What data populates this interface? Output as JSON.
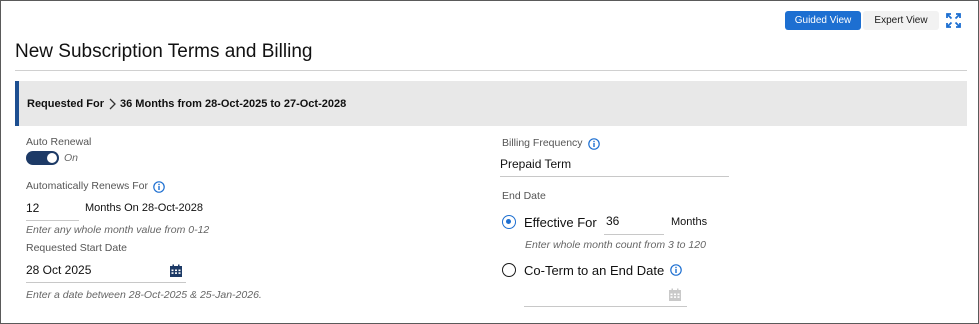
{
  "view_toggle": {
    "guided": "Guided View",
    "expert": "Expert View"
  },
  "page_title": "New Subscription Terms and Billing",
  "banner": {
    "label": "Requested For",
    "value": "36 Months from 28-Oct-2025 to 27-Oct-2028"
  },
  "left": {
    "auto_renewal_label": "Auto Renewal",
    "auto_renewal_state": "On",
    "renews_for_label": "Automatically Renews For",
    "renews_for_value": "12",
    "renews_for_suffix": "Months On 28-Oct-2028",
    "renews_for_hint": "Enter any whole month value from 0-12",
    "start_date_label": "Requested Start Date",
    "start_date_value": "28 Oct 2025",
    "start_date_hint": "Enter a date between 28-Oct-2025 & 25-Jan-2026."
  },
  "right": {
    "billing_label": "Billing Frequency",
    "billing_value": "Prepaid Term",
    "end_date_label": "End Date",
    "effective_for_label": "Effective For",
    "effective_for_value": "36",
    "effective_for_suffix": "Months",
    "effective_for_hint": "Enter whole month count from 3 to 120",
    "coterm_label": "Co-Term to an End Date"
  },
  "colors": {
    "accent": "#1d6fd1",
    "banner_bar": "#1d4f91",
    "switch": "#1d3a66"
  }
}
